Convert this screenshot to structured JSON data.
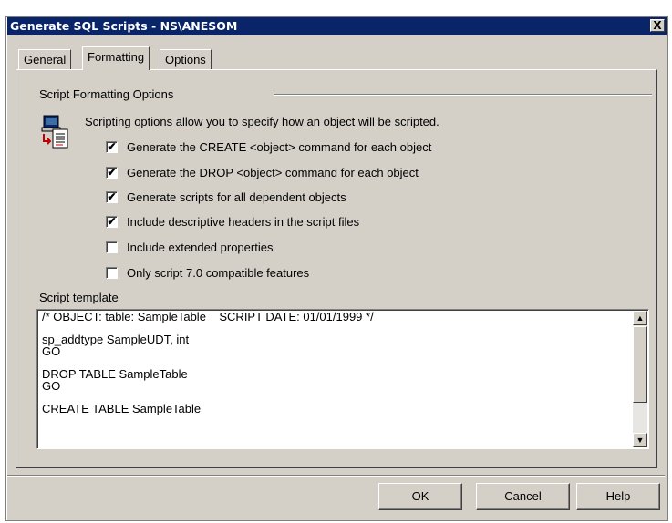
{
  "window": {
    "title": "Generate SQL Scripts - NS\\ANESOM",
    "close_label": "X"
  },
  "tabs": [
    {
      "label": "General",
      "active": false
    },
    {
      "label": "Formatting",
      "active": true
    },
    {
      "label": "Options",
      "active": false
    }
  ],
  "formatting": {
    "group_label": "Script Formatting Options",
    "description": "Scripting options allow you to specify how an object will be scripted.",
    "icon": "script-properties-icon",
    "options": [
      {
        "label": "Generate the CREATE <object> command for each object",
        "checked": true
      },
      {
        "label": "Generate the DROP <object> command for each object",
        "checked": true
      },
      {
        "label": "Generate scripts for all dependent objects",
        "checked": true
      },
      {
        "label": "Include descriptive headers in the script files",
        "checked": true
      },
      {
        "label": "Include extended properties",
        "checked": false
      },
      {
        "label": "Only script 7.0 compatible features",
        "checked": false
      }
    ]
  },
  "template": {
    "label": "Script template",
    "lines": [
      "/* OBJECT: table: SampleTable    SCRIPT DATE: 01/01/1999 */",
      "",
      "sp_addtype SampleUDT, int",
      "GO",
      "",
      "DROP TABLE SampleTable",
      "GO",
      "",
      "CREATE TABLE SampleTable"
    ]
  },
  "buttons": {
    "ok": "OK",
    "cancel": "Cancel",
    "help": "Help"
  },
  "colors": {
    "titlebar": "#0a246a",
    "face": "#d4d0c8"
  }
}
